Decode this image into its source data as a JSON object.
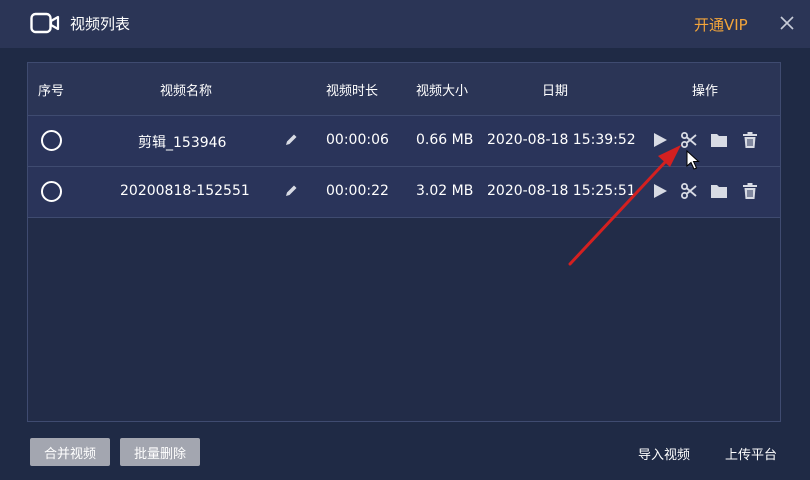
{
  "window": {
    "title": "视频列表",
    "vip_label": "开通VIP"
  },
  "table": {
    "headers": {
      "index": "序号",
      "name": "视频名称",
      "duration": "视频时长",
      "size": "视频大小",
      "date": "日期",
      "actions": "操作"
    },
    "rows": [
      {
        "name": "剪辑_153946",
        "duration": "00:00:06",
        "size": "0.66 MB",
        "date": "2020-08-18 15:39:52"
      },
      {
        "name": "20200818-152551",
        "duration": "00:00:22",
        "size": "3.02 MB",
        "date": "2020-08-18 15:25:51"
      }
    ]
  },
  "footer": {
    "merge_label": "合并视频",
    "batch_delete_label": "批量删除",
    "import_label": "导入视频",
    "upload_label": "上传平台"
  },
  "icons": [
    "camera-icon",
    "close-icon",
    "edit-icon",
    "play-icon",
    "scissors-icon",
    "folder-icon",
    "trash-icon"
  ],
  "colors": {
    "accent": "#f3a53a",
    "background": "#1f2a45",
    "header": "#2b3556",
    "row": "#2a345a",
    "button": "#a3a6b0",
    "arrow": "#d42020"
  }
}
